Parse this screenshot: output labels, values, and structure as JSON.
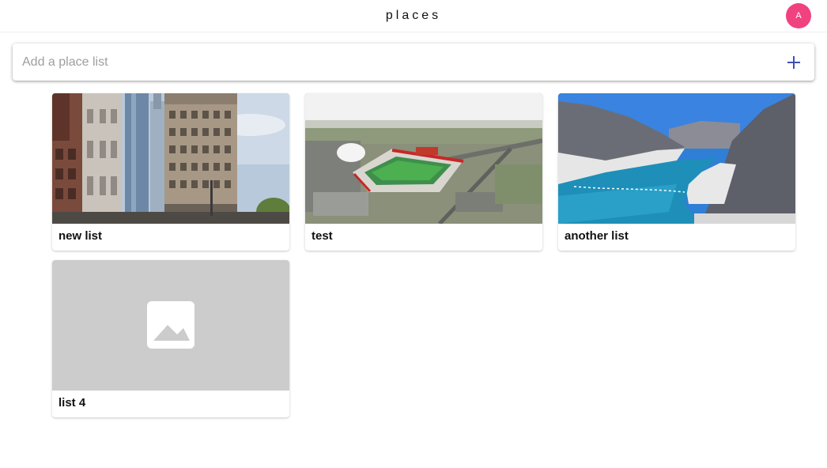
{
  "header": {
    "title": "places",
    "avatar_initial": "A",
    "avatar_color": "#f0427f"
  },
  "add_list": {
    "placeholder": "Add a place list",
    "value": "",
    "add_icon": "plus-icon",
    "accent_color": "#3f51b5"
  },
  "lists": [
    {
      "label": "new list",
      "image": "city-buildings-photo"
    },
    {
      "label": "test",
      "image": "stadium-aerial-photo"
    },
    {
      "label": "another list",
      "image": "lake-canyon-photo"
    },
    {
      "label": "list 4",
      "image": "image-placeholder-icon"
    }
  ]
}
